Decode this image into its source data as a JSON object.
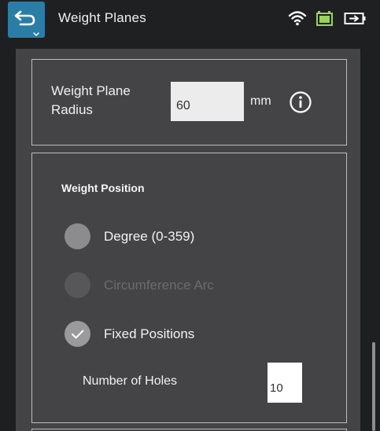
{
  "header": {
    "title": "Weight Planes",
    "icons": [
      "back-arrow-icon",
      "wifi-icon",
      "battery-icon",
      "power-plug-battery-icon"
    ],
    "accent": "#2a7ea6"
  },
  "radius": {
    "label": "Weight Plane Radius",
    "value": "60",
    "unit": "mm",
    "info_icon": "info-icon"
  },
  "weight_position": {
    "title": "Weight Position",
    "options": [
      {
        "label": "Degree (0-359)",
        "state": "unchecked",
        "enabled": true
      },
      {
        "label": "Circumference Arc",
        "state": "unchecked",
        "enabled": false
      },
      {
        "label": "Fixed Positions",
        "state": "checked",
        "enabled": true
      }
    ],
    "holes_label": "Number of Holes",
    "holes_value": "10"
  }
}
